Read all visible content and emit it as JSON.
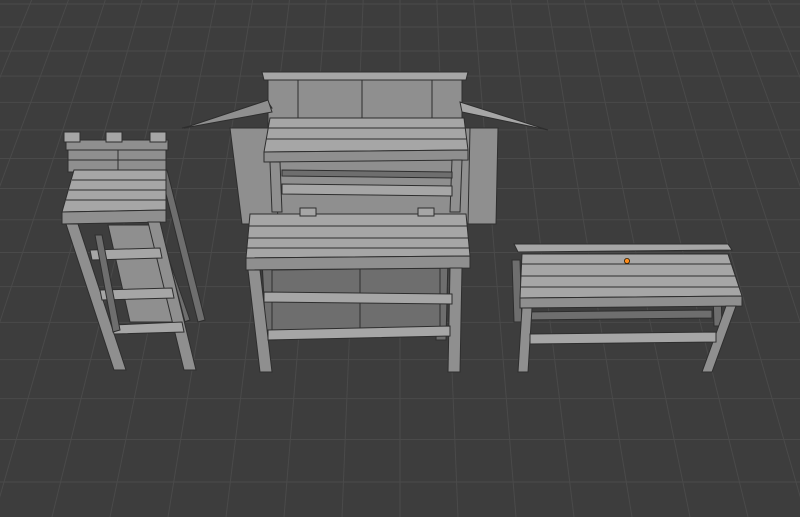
{
  "viewport": {
    "background_color": "#3d3d3d",
    "grid_line_color": "#4a4a4a",
    "model_face_color": "#8f8f8f",
    "model_light_color": "#a6a6a6",
    "model_dark_color": "#6e6e6e",
    "model_edge_color": "#2e2e2e",
    "origin_marker_color": "#ff8c1a",
    "scene_objects": [
      {
        "name": "tall-shelf-tower"
      },
      {
        "name": "roofed-market-stall"
      },
      {
        "name": "two-tier-plank-table"
      },
      {
        "name": "low-plank-bench"
      }
    ]
  }
}
